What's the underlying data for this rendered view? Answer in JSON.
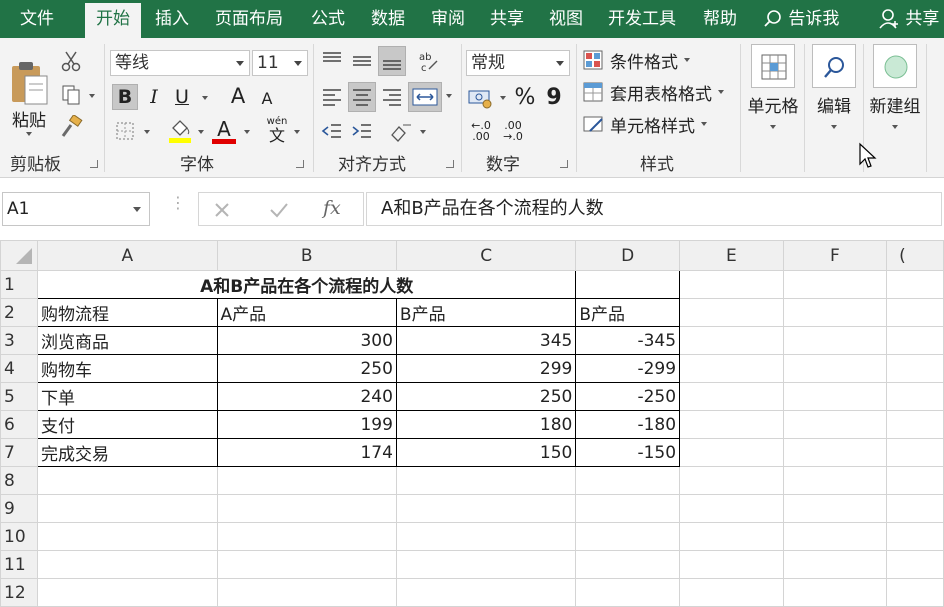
{
  "tabs": [
    "文件",
    "开始",
    "插入",
    "页面布局",
    "公式",
    "数据",
    "审阅",
    "共享",
    "视图",
    "开发工具",
    "帮助",
    "告诉我",
    "共享"
  ],
  "ribbon": {
    "clipboard": {
      "paste": "粘贴",
      "label": "剪贴板"
    },
    "font": {
      "name": "等线",
      "size": "11",
      "label": "字体",
      "bold": "B",
      "italic": "I",
      "underline": "U",
      "grow": "A",
      "shrink": "A",
      "color_a": "A",
      "phonetic_top": "wén",
      "phonetic": "文"
    },
    "alignment": {
      "label": "对齐方式"
    },
    "number": {
      "format": "常规",
      "label": "数字",
      "percent": "%",
      "comma": "9",
      "inc_dec": "←.0 .00",
      "dec_dec": ".00 →.0"
    },
    "styles": {
      "conditional": "条件格式",
      "table": "套用表格格式",
      "cell": "单元格样式",
      "label": "样式"
    },
    "cells": {
      "label": "单元格"
    },
    "editing": {
      "label": "编辑"
    },
    "new_group": {
      "label": "新建组"
    }
  },
  "formula_bar": {
    "name_box": "A1",
    "fx": "fx",
    "content": "A和B产品在各个流程的人数"
  },
  "columns": [
    "A",
    "B",
    "C",
    "D",
    "E",
    "F",
    "G"
  ],
  "rows": [
    {
      "n": "1",
      "cells": [
        "A和B产品在各个流程的人数",
        "",
        "",
        ""
      ]
    },
    {
      "n": "2",
      "cells": [
        "购物流程",
        "A产品",
        "B产品",
        "B产品"
      ]
    },
    {
      "n": "3",
      "cells": [
        "浏览商品",
        "300",
        "345",
        "-345"
      ]
    },
    {
      "n": "4",
      "cells": [
        "购物车",
        "250",
        "299",
        "-299"
      ]
    },
    {
      "n": "5",
      "cells": [
        "下单",
        "240",
        "250",
        "-250"
      ]
    },
    {
      "n": "6",
      "cells": [
        "支付",
        "199",
        "180",
        "-180"
      ]
    },
    {
      "n": "7",
      "cells": [
        "完成交易",
        "174",
        "150",
        "-150"
      ]
    },
    {
      "n": "8",
      "cells": []
    },
    {
      "n": "9",
      "cells": []
    },
    {
      "n": "10",
      "cells": []
    },
    {
      "n": "11",
      "cells": []
    },
    {
      "n": "12",
      "cells": []
    }
  ],
  "colors": {
    "accent": "#217346",
    "highlight_yellow": "#ffff00",
    "font_red": "#e00000"
  }
}
